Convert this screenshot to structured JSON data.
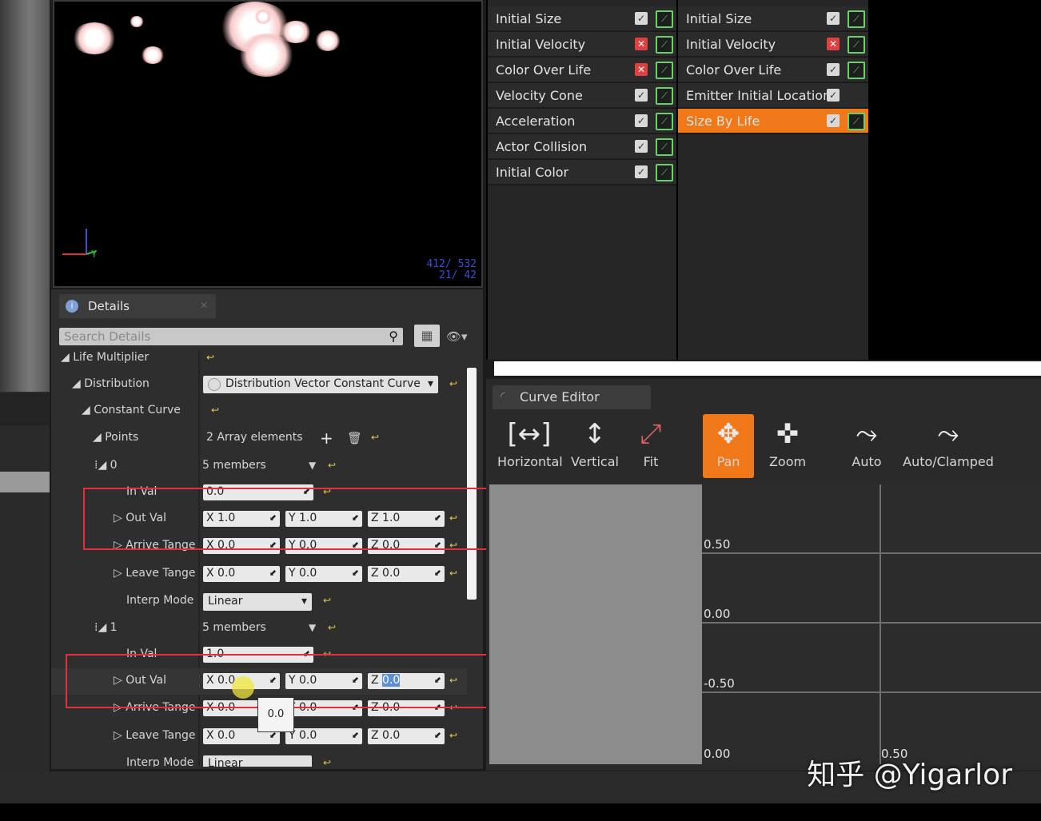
{
  "viewport": {
    "counts_line1": "412/ 532",
    "counts_line2": "21/ 42",
    "axis_y": "Y"
  },
  "details": {
    "tab_label": "Details",
    "search_placeholder": "Search Details",
    "rows": {
      "life_multiplier": "Life Multiplier",
      "distribution": "Distribution",
      "distribution_value": "Distribution Vector Constant Curve",
      "constant_curve": "Constant Curve",
      "points": "Points",
      "points_value": "2 Array elements",
      "p0": "0",
      "p0_value": "5 members",
      "in_val": "In Val",
      "in_val_0": "0.0",
      "out_val": "Out Val",
      "out_val_0": {
        "x": "1.0",
        "y": "1.0",
        "z": "1.0"
      },
      "arrive_tangent": "Arrive Tange",
      "arrive_0": {
        "x": "0.0",
        "y": "0.0",
        "z": "0.0"
      },
      "leave_tangent": "Leave Tange",
      "leave_0": {
        "x": "0.0",
        "y": "0.0",
        "z": "0.0"
      },
      "interp_mode": "Interp Mode",
      "interp_value": "Linear",
      "p1": "1",
      "p1_value": "5 members",
      "in_val_1": "1.0",
      "out_val_1": {
        "x": "0.0",
        "y": "0.0",
        "z": "0.0"
      },
      "arrive_1": {
        "x": "0.0",
        "y": "0.0",
        "z": "0.0"
      },
      "leave_1": {
        "x": "0.0",
        "y": "0.0",
        "z": "0.0"
      },
      "interp_mode_cut": "Interp Mode",
      "interp_value_cut": "Linear"
    },
    "tooltip": "0.0",
    "axis_x": "X",
    "axis_y": "Y",
    "axis_z": "Z"
  },
  "emitters": {
    "col1": [
      "Initial Size",
      "Initial Velocity",
      "Color Over Life",
      "Velocity Cone",
      "Acceleration",
      "Actor Collision",
      "Initial Color"
    ],
    "col1_off": [
      false,
      true,
      true,
      false,
      false,
      false,
      false
    ],
    "col2": [
      "Initial Size",
      "Initial Velocity",
      "Color Over Life",
      "Emitter Initial Location",
      "Size By Life"
    ],
    "col2_off": [
      false,
      true,
      false,
      false,
      false
    ]
  },
  "curve_editor": {
    "tab_label": "Curve Editor",
    "tools": [
      "Horizontal",
      "Vertical",
      "Fit",
      "Pan",
      "Zoom",
      "Auto",
      "Auto/Clamped"
    ],
    "active_tool": "Pan",
    "y_labels": [
      "0.50",
      "0.00",
      "-0.50",
      "0.00"
    ],
    "x_label": "0.50"
  },
  "watermark": "知乎 @Yigarlor",
  "colors": {
    "accent": "#f07818",
    "highlight_box": "#e0313a",
    "graph_green": "#6bd06b"
  }
}
